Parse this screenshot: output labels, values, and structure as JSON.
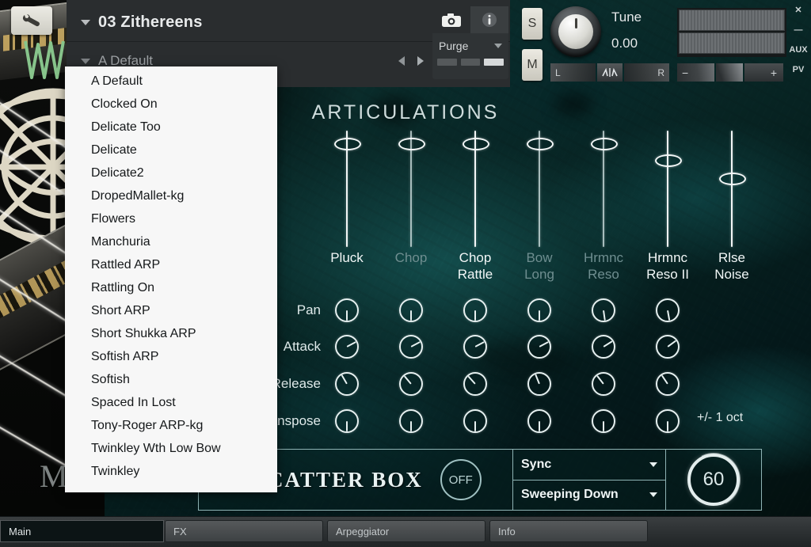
{
  "window": {
    "rail_items": [
      "✕",
      "—",
      "AUX",
      "PV"
    ]
  },
  "header": {
    "instrument_name": "03 Zithereens",
    "preset_name": "A Default",
    "instrument_caret_icon": "chevron-down-icon",
    "preset_caret_icon": "chevron-down-icon",
    "prev_icon": "arrow-left-icon",
    "next_icon": "arrow-right-icon",
    "save_icon": "floppy-disk-icon",
    "delete_icon": "trash-icon",
    "snapshot_icon": "camera-icon",
    "info_icon": "info-icon",
    "purge_label": "Purge",
    "solo_label": "S",
    "mute_label": "M",
    "tune_label": "Tune",
    "tune_value": "0.00",
    "pan_left": "L",
    "pan_right": "R",
    "pan_center_icon": "pan-center-icon",
    "volume_minus": "−",
    "volume_plus": "+"
  },
  "preset_dropdown": {
    "open": true,
    "items": [
      "A Default",
      "Clocked On",
      "Delicate Too",
      "Delicate",
      "Delicate2",
      "DropedMallet-kg",
      "Flowers",
      "Manchuria",
      "Rattled ARP",
      "Rattling On",
      "Short ARP",
      "Short Shukka ARP",
      "Softish ARP",
      "Softish",
      "Spaced In Lost",
      "Tony-Roger ARP-kg",
      "Twinkley Wth Low Bow",
      "Twinkley"
    ]
  },
  "articulations": {
    "title": "ARTICULATIONS",
    "columns": [
      {
        "label_line1": "Pluck",
        "label_line2": "",
        "active": true,
        "slider_value": 0.88
      },
      {
        "label_line1": "Chop",
        "label_line2": "",
        "active": false,
        "slider_value": 0.88
      },
      {
        "label_line1": "Chop",
        "label_line2": "Rattle",
        "active": true,
        "slider_value": 0.88
      },
      {
        "label_line1": "Bow",
        "label_line2": "Long",
        "active": false,
        "slider_value": 0.88
      },
      {
        "label_line1": "Hrmnc",
        "label_line2": "Reso",
        "active": false,
        "slider_value": 0.88
      },
      {
        "label_line1": "Hrmnc",
        "label_line2": "Reso II",
        "active": true,
        "slider_value": 0.74
      },
      {
        "label_line1": "Rlse",
        "label_line2": "Noise",
        "active": true,
        "slider_value": 0.58
      }
    ]
  },
  "knob_grid": {
    "rows": [
      {
        "label": "Pan",
        "values": [
          0,
          0,
          0,
          0,
          -8,
          -10
        ]
      },
      {
        "label": "Attack",
        "values": [
          -118,
          -118,
          -118,
          -118,
          -122,
          -126
        ]
      },
      {
        "label": "Release",
        "values": [
          150,
          140,
          138,
          158,
          142,
          146
        ]
      },
      {
        "label": "Transpose",
        "values": [
          0,
          0,
          0,
          0,
          0,
          0
        ]
      }
    ],
    "transpose_note": "+/- 1 oct"
  },
  "scatter_box": {
    "title": "SCATTER BOX",
    "power_label": "OFF",
    "mode_label": "Sync",
    "pattern_label": "Sweeping Down",
    "rate_value": "60",
    "mode_caret_icon": "chevron-down-icon",
    "pattern_caret_icon": "chevron-down-icon"
  },
  "tabs": [
    {
      "label": "Main",
      "active": true
    },
    {
      "label": "FX",
      "active": false
    },
    {
      "label": "Arpeggiator",
      "active": false
    },
    {
      "label": "Info",
      "active": false
    }
  ],
  "artwork": {
    "watermark": "M"
  }
}
